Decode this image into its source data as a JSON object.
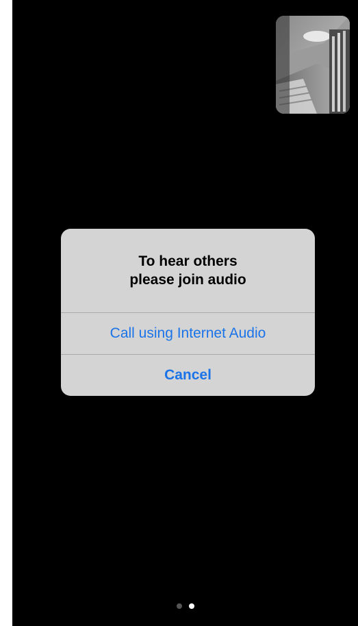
{
  "alert": {
    "title_line1": "To hear others",
    "title_line2": "please join audio",
    "internet_audio_label": "Call using Internet Audio",
    "cancel_label": "Cancel"
  },
  "pager": {
    "total_pages": 2,
    "current_page": 2
  },
  "colors": {
    "background": "#000000",
    "alert_background": "#d4d4d4",
    "action_blue": "#1a73e8"
  }
}
